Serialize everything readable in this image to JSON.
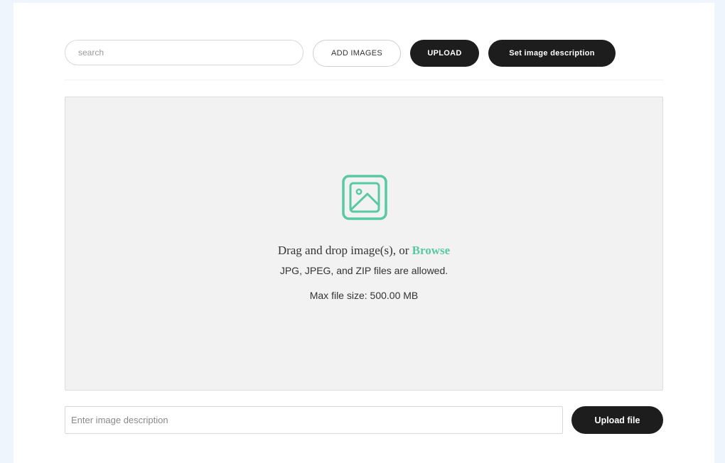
{
  "toolbar": {
    "search_placeholder": "search",
    "add_images_label": "ADD IMAGES",
    "upload_label": "UPLOAD",
    "set_description_label": "Set image description"
  },
  "dropzone": {
    "icon": "image-icon",
    "drag_text": "Drag and drop image(s), or",
    "browse_link": "Browse",
    "allowed_text": "JPG, JPEG, and ZIP files are allowed.",
    "max_size_text": "Max file size: 500.00 MB"
  },
  "description": {
    "placeholder": "Enter image description",
    "value": ""
  },
  "upload_file_label": "Upload file",
  "colors": {
    "accent": "#58c9a3",
    "button_dark": "#1d1d1d",
    "dropzone_bg": "#f2f2f2",
    "page_bg": "#eef5fd"
  }
}
